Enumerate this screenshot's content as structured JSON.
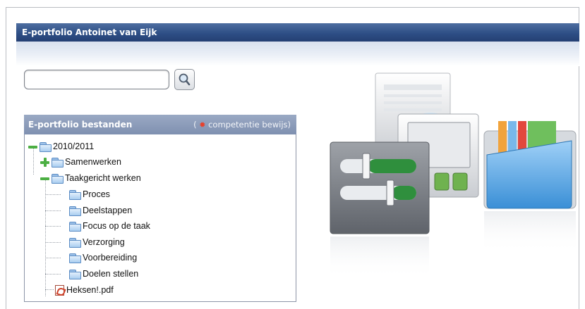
{
  "header": {
    "title": "E-portfolio Antoinet van Eijk"
  },
  "search": {
    "value": "",
    "placeholder": ""
  },
  "panel": {
    "title": "E-portfolio bestanden",
    "legend_open": "(",
    "legend_text": "competentie bewijs)"
  },
  "tree": {
    "items": [
      {
        "label": "2010/2011",
        "type": "folder",
        "state": "expanded",
        "level": 0
      },
      {
        "label": "Samenwerken",
        "type": "folder",
        "state": "collapsed",
        "level": 1
      },
      {
        "label": "Taakgericht werken",
        "type": "folder",
        "state": "expanded",
        "level": 1
      },
      {
        "label": "Proces",
        "type": "folder",
        "level": 2
      },
      {
        "label": "Deelstappen",
        "type": "folder",
        "level": 2
      },
      {
        "label": "Focus op de taak",
        "type": "folder",
        "level": 2
      },
      {
        "label": "Verzorging",
        "type": "folder",
        "level": 2
      },
      {
        "label": "Voorbereiding",
        "type": "folder",
        "level": 2
      },
      {
        "label": "Doelen stellen",
        "type": "folder",
        "level": 2
      },
      {
        "label": "Heksen!.pdf",
        "type": "pdf",
        "level": 1
      }
    ]
  },
  "icons": {
    "search_button": "magnifier-icon",
    "legend_marker": "star-icon",
    "illustration": "media-folder-illustration"
  },
  "colors": {
    "title_bar": "#2e4f86",
    "panel_header": "#8797b6",
    "toggle_green": "#4caf43",
    "folder_blue": "#a9cdf0"
  }
}
